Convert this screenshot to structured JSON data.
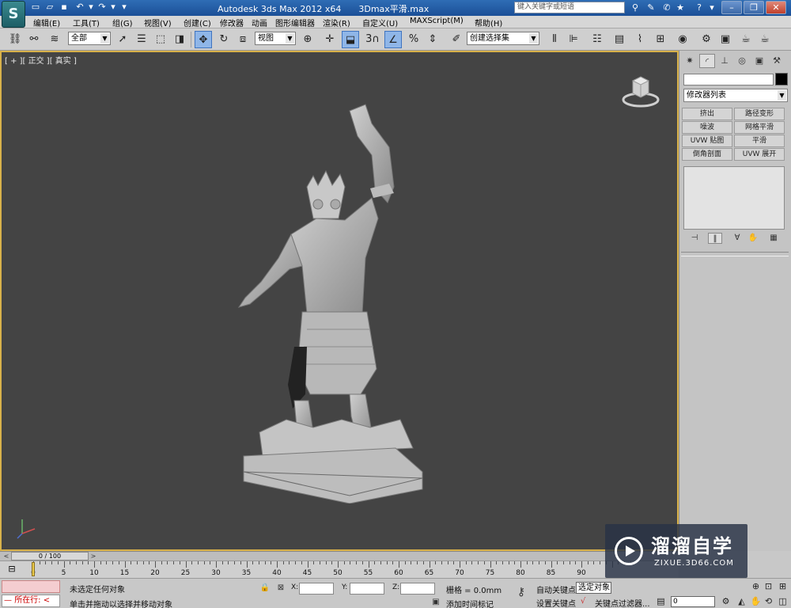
{
  "titlebar": {
    "app_title": "Autodesk 3ds Max  2012 x64",
    "file_name": "3Dmax平滑.max",
    "search_placeholder": "键入关键字或短语"
  },
  "menubar": {
    "items": [
      "编辑(E)",
      "工具(T)",
      "组(G)",
      "视图(V)",
      "创建(C)",
      "修改器",
      "动画",
      "图形编辑器",
      "渲染(R)",
      "自定义(U)",
      "MAXScript(M)",
      "帮助(H)"
    ]
  },
  "toolbar": {
    "selection_filter": "全部",
    "reference_coord": "视图",
    "named_selection_set": "创建选择集",
    "snap_label": "3"
  },
  "viewport": {
    "label": "[ + ][ 正交 ][ 真实 ]"
  },
  "command_panel": {
    "modifier_list": "修改器列表",
    "modifier_buttons": [
      "挤出",
      "路径变形",
      "噪波",
      "网格平滑",
      "UVW 贴图",
      "平滑",
      "倒角剖面",
      "UVW 展开"
    ]
  },
  "timeslider": {
    "position": "0 / 100",
    "current_frame_fraction": 0,
    "prev_arrow": "<",
    "next_arrow": ">"
  },
  "trackbar": {
    "tick_labels": [
      "0",
      "5",
      "10",
      "15",
      "20",
      "25",
      "30",
      "35",
      "40",
      "45",
      "50",
      "55",
      "60",
      "65",
      "70",
      "75",
      "80",
      "85",
      "90"
    ]
  },
  "statusbar": {
    "running_label": "所在行:",
    "selection_status": "未选定任何对象",
    "prompt": "单击并拖动以选择并移动对象",
    "x_label": "X:",
    "y_label": "Y:",
    "z_label": "Z:",
    "grid": "栅格 = 0.0mm",
    "add_time_tag": "添加时间标记",
    "auto_key": "自动关键点",
    "set_key": "设置关键点",
    "selected_object": "选定对象",
    "key_filters": "关键点过滤器...",
    "frame_value": "0"
  },
  "watermark": {
    "brand_cn": "溜溜自学",
    "brand_en": "ZIXUE.3D66.COM"
  }
}
